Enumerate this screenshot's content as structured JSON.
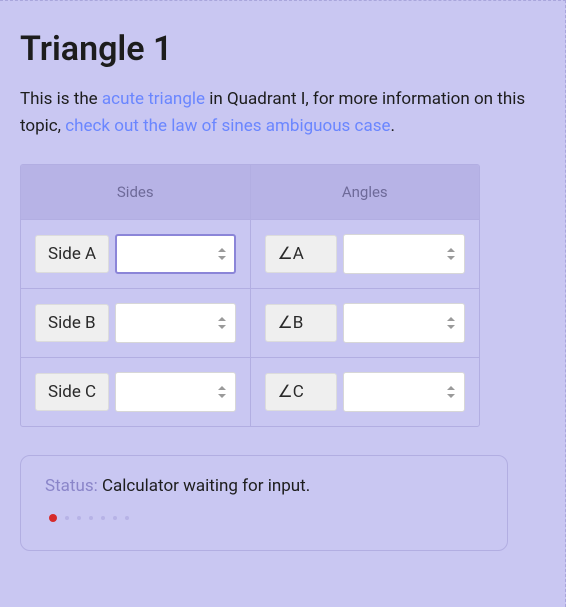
{
  "title": "Triangle 1",
  "intro": {
    "before": "This is the ",
    "link1": "acute triangle",
    "mid": " in Quadrant I, for more information on this topic, ",
    "link2": "check out the law of sines ambiguous case",
    "after": "."
  },
  "headers": {
    "sides": "Sides",
    "angles": "Angles"
  },
  "rows": [
    {
      "side_label": "Side A",
      "side_value": "",
      "angle_label": "∠A",
      "angle_value": ""
    },
    {
      "side_label": "Side B",
      "side_value": "",
      "angle_label": "∠B",
      "angle_value": ""
    },
    {
      "side_label": "Side C",
      "side_value": "",
      "angle_label": "∠C",
      "angle_value": ""
    }
  ],
  "status": {
    "label": "Status: ",
    "message": "Calculator waiting for input."
  }
}
